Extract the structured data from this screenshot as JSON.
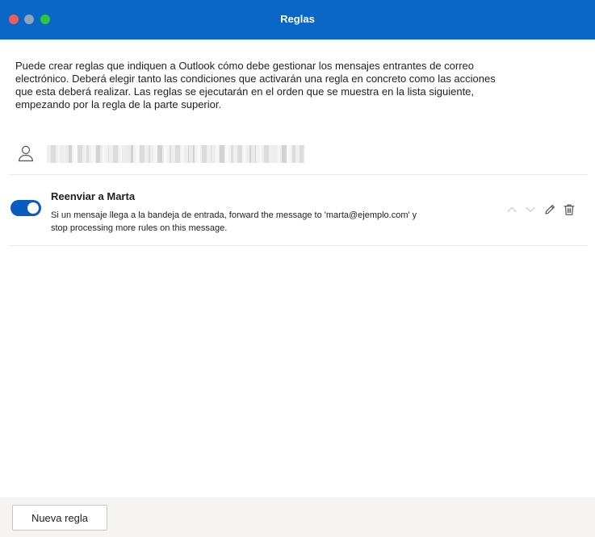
{
  "window": {
    "title": "Reglas"
  },
  "intro": {
    "text": "Puede crear reglas que indiquen a Outlook cómo debe gestionar los mensajes entrantes de correo electrónico. Deberá elegir tanto las condiciones que activarán una regla en concreto como las acciones que esta deberá realizar. Las reglas se ejecutarán en el orden que se muestra en la lista siguiente, empezando por la regla de la parte superior."
  },
  "account": {
    "icon": "person-icon",
    "name": "",
    "name_blurred": true
  },
  "rules": [
    {
      "enabled": true,
      "name": "Reenviar a Marta",
      "description": "Si un mensaje llega a la bandeja de entrada, forward the message to 'marta@ejemplo.com' y stop processing more rules on this message.",
      "actions": [
        "chevron-up-icon",
        "chevron-down-icon",
        "pencil-icon",
        "trash-icon"
      ]
    }
  ],
  "footer": {
    "new_rule_label": "Nueva regla"
  },
  "colors": {
    "titlebar": "#0a66c7",
    "toggle_on": "#0a5bbf",
    "close": "#ee5f57",
    "minimize": "#8fa3bd",
    "maximize": "#2ec840"
  }
}
